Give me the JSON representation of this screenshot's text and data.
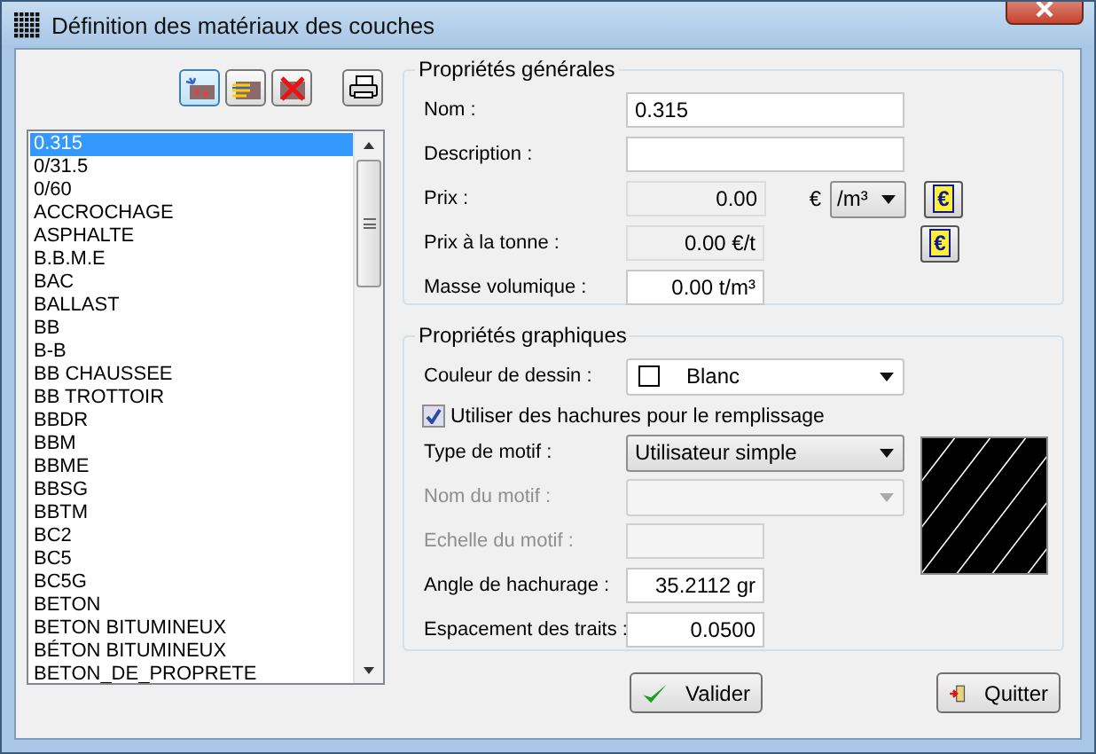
{
  "window": {
    "title": "Définition des matériaux des couches"
  },
  "materials": [
    {
      "label": "0.315",
      "selected": true
    },
    {
      "label": "0/31.5",
      "selected": false
    },
    {
      "label": "0/60",
      "selected": false
    },
    {
      "label": "ACCROCHAGE",
      "selected": false
    },
    {
      "label": "ASPHALTE",
      "selected": false
    },
    {
      "label": "B.B.M.E",
      "selected": false
    },
    {
      "label": "BAC",
      "selected": false
    },
    {
      "label": "BALLAST",
      "selected": false
    },
    {
      "label": "BB",
      "selected": false
    },
    {
      "label": "B-B",
      "selected": false
    },
    {
      "label": "BB CHAUSSEE",
      "selected": false
    },
    {
      "label": "BB TROTTOIR",
      "selected": false
    },
    {
      "label": "BBDR",
      "selected": false
    },
    {
      "label": "BBM",
      "selected": false
    },
    {
      "label": "BBME",
      "selected": false
    },
    {
      "label": "BBSG",
      "selected": false
    },
    {
      "label": "BBTM",
      "selected": false
    },
    {
      "label": "BC2",
      "selected": false
    },
    {
      "label": "BC5",
      "selected": false
    },
    {
      "label": "BC5G",
      "selected": false
    },
    {
      "label": "BETON",
      "selected": false
    },
    {
      "label": "BETON BITUMINEUX",
      "selected": false
    },
    {
      "label": "BÉTON BITUMINEUX",
      "selected": false
    },
    {
      "label": "BETON_DE_PROPRETE",
      "selected": false
    }
  ],
  "general": {
    "title": "Propriétés générales",
    "name": {
      "label": "Nom :",
      "value": "0.315"
    },
    "description": {
      "label": "Description :"
    },
    "price": {
      "label": "Prix :",
      "value": "0.00",
      "currency": "€",
      "unit": "/m³"
    },
    "price_per_ton": {
      "label": "Prix à la tonne :",
      "value": "0.00 €/t"
    },
    "density": {
      "label": "Masse volumique :",
      "value": "0.00 t/m³"
    }
  },
  "graphic": {
    "title": "Propriétés graphiques",
    "color": {
      "label": "Couleur de dessin :",
      "value": "Blanc"
    },
    "use_hatching": {
      "label": "Utiliser des hachures pour le remplissage",
      "checked": true
    },
    "pattern_type": {
      "label": "Type de motif :",
      "value": "Utilisateur simple"
    },
    "pattern_name": {
      "label": "Nom du motif :",
      "disabled": true
    },
    "pattern_scale": {
      "label": "Echelle du motif :",
      "disabled": true
    },
    "hatch_angle": {
      "label": "Angle de hachurage :",
      "value": "35.2112 gr"
    },
    "line_spacing": {
      "label": "Espacement des traits :",
      "value": "0.0500"
    }
  },
  "buttons": {
    "ok": "Valider",
    "quit": "Quitter"
  }
}
